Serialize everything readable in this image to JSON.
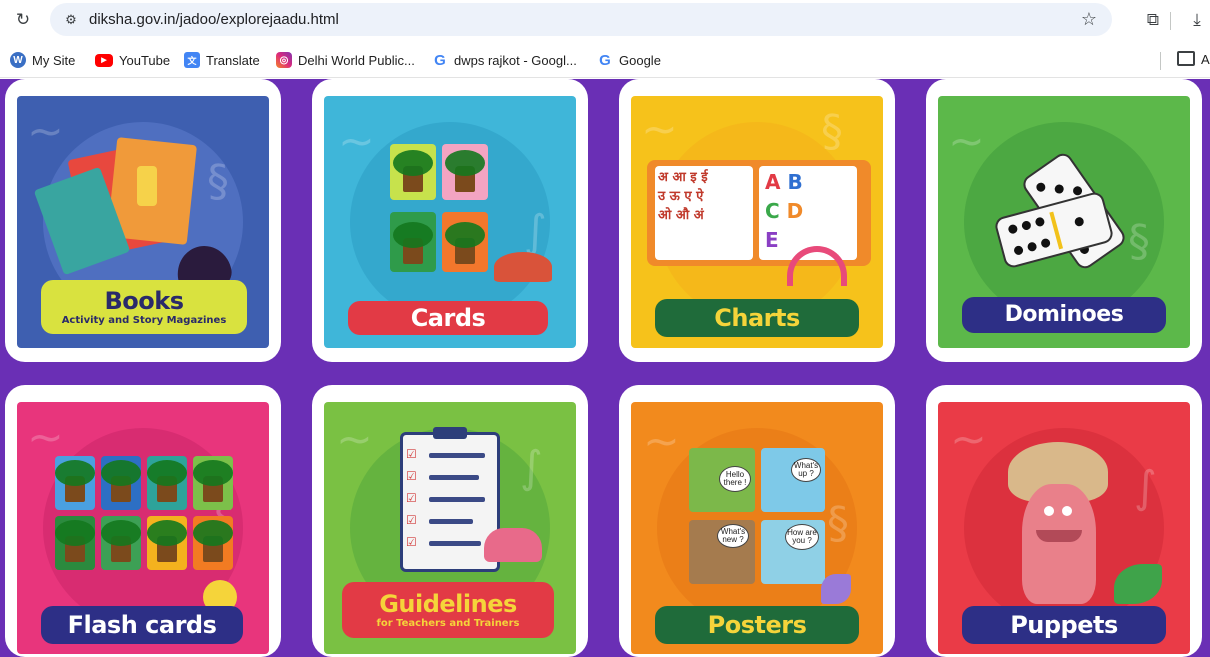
{
  "browser": {
    "url": "diksha.gov.in/jadoo/explorejaadu.html",
    "icons": [
      "reload-icon",
      "site-info-icon",
      "bookmark-star-icon",
      "extensions-icon",
      "download-icon",
      "folder-icon"
    ],
    "bookmarks": [
      {
        "label": "My Site",
        "icon": "wordpress-icon"
      },
      {
        "label": "YouTube",
        "icon": "youtube-icon"
      },
      {
        "label": "Translate",
        "icon": "translate-icon"
      },
      {
        "label": "Delhi World Public...",
        "icon": "instagram-icon"
      },
      {
        "label": "dwps rajkot - Googl...",
        "icon": "google-icon"
      },
      {
        "label": "Google",
        "icon": "google-icon"
      }
    ],
    "overflow_folder_label": "A"
  },
  "page": {
    "background": "#6a2fb5",
    "cards": [
      {
        "title": "Books",
        "subtitle": "Activity and Story Magazines",
        "bg": "#3e5fb0",
        "banner_color": "#d9e23f",
        "banner_text_color": "#2a2a6a"
      },
      {
        "title": "Cards",
        "subtitle": "",
        "bg": "#3fb6d9",
        "banner_color": "#e23a45",
        "banner_text_color": "#ffffff"
      },
      {
        "title": "Charts",
        "subtitle": "",
        "bg": "#f6c21b",
        "banner_color": "#1f6b3a",
        "banner_text_color": "#f5d43a"
      },
      {
        "title": "Dominoes",
        "subtitle": "",
        "bg": "#5cb84a",
        "banner_color": "#2d2f86",
        "banner_text_color": "#ffffff"
      },
      {
        "title": "Flash cards",
        "subtitle": "",
        "bg": "#e8357c",
        "banner_color": "#2d2f86",
        "banner_text_color": "#ffffff"
      },
      {
        "title": "Guidelines",
        "subtitle": "for Teachers and Trainers",
        "bg": "#7ac143",
        "banner_color": "#e23a45",
        "banner_text_color": "#f5d43a"
      },
      {
        "title": "Posters",
        "subtitle": "",
        "bg": "#f28a1d",
        "banner_color": "#1f6b3a",
        "banner_text_color": "#f5d43a"
      },
      {
        "title": "Puppets",
        "subtitle": "",
        "bg": "#ea3b47",
        "banner_color": "#2d2f86",
        "banner_text_color": "#ffffff"
      }
    ],
    "posters": {
      "bubbles": [
        "Hello there !",
        "What's up ?",
        "What's new ?",
        "How are you ?"
      ]
    },
    "charts": {
      "letters": [
        "A",
        "B",
        "C",
        "D",
        "E"
      ],
      "hindi": [
        "अ",
        "आ",
        "इ",
        "ई",
        "उ",
        "ऊ",
        "ए",
        "ऐ",
        "ओ",
        "औ",
        "अं"
      ]
    }
  }
}
